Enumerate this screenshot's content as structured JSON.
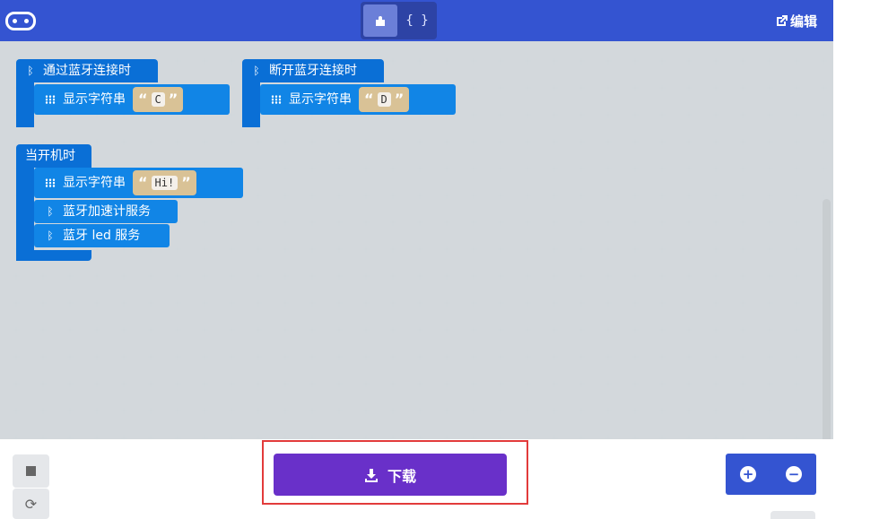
{
  "header": {
    "logo_icon": "microbit-logo-icon",
    "toggle": {
      "blocks_icon": "puzzle-icon",
      "javascript_label": "{ }",
      "selected": "blocks"
    },
    "edit_label": "编辑",
    "edit_icon": "external-link-icon"
  },
  "workspace": {
    "blocks": [
      {
        "event": "通过蓝牙连接时",
        "statement": "显示字符串",
        "string": "C"
      },
      {
        "event": "断开蓝牙连接时",
        "statement": "显示字符串",
        "string": "D"
      },
      {
        "event": "当开机时",
        "statement": "显示字符串",
        "string": "Hi!",
        "extra": [
          "蓝牙加速计服务",
          "蓝牙 led 服务"
        ]
      }
    ],
    "quote_open": "“",
    "quote_close": "”"
  },
  "bottom": {
    "download_label": "下载",
    "download_icon": "download-icon",
    "zoom_in_icon": "zoom-in-icon",
    "zoom_out_icon": "zoom-out-icon",
    "stop_icon": "stop-icon",
    "restart_icon": "restart-icon"
  },
  "colors": {
    "brand": "#3454d1",
    "block_dark": "#0a6fd6",
    "block": "#1185e6",
    "download": "#6930c9",
    "highlight": "#e23b3b"
  }
}
